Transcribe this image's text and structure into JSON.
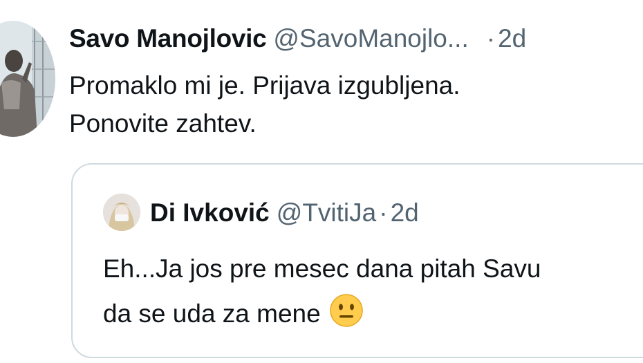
{
  "tweet": {
    "author_name": "Savo Manojlovic",
    "author_handle": "@SavoManojlo...",
    "separator": "·",
    "time": "2d",
    "text_line1": "Promaklo mi je. Prijava izgubljena.",
    "text_line2": "Ponovite zahtev."
  },
  "quote": {
    "author_name": "Di Ivković",
    "author_handle": "@TvitiJa",
    "separator": "·",
    "time": "2d",
    "text_line1": "Eh...Ja jos pre mesec dana pitah Savu",
    "text_line2": "da se uda za mene",
    "emoji": "neutral-face-emoji"
  },
  "colors": {
    "text_primary": "#0f1419",
    "text_secondary": "#536471",
    "border": "#cfd9de",
    "emoji_yellow": "#ffcc4d"
  }
}
